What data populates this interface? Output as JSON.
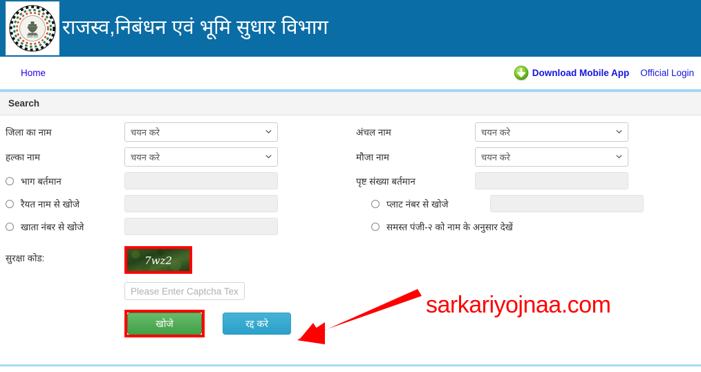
{
  "header": {
    "emblem_alt": "government-emblem",
    "title": "राजस्व,निबंधन एवं भूमि सुधार विभाग",
    "background_color": "#0a6da6"
  },
  "nav": {
    "home_label": "Home",
    "download_label": "Download Mobile App",
    "download_icon": "download-circle-icon",
    "official_login_label": "Official Login",
    "link_color": "#1515e0",
    "accent_rule_color": "#9fd6f5"
  },
  "panel": {
    "title": "Search",
    "left_column": [
      {
        "label": "जिला का नाम",
        "control": "select",
        "value": "चयन करे",
        "has_radio": false
      },
      {
        "label": "हल्का नाम",
        "control": "select",
        "value": "चयन करे",
        "has_radio": false
      },
      {
        "label": "भाग बर्तमान",
        "control": "input",
        "value": "",
        "has_radio": true
      },
      {
        "label": "रैयत नाम से खोजे",
        "control": "input",
        "value": "",
        "has_radio": true
      },
      {
        "label": "खाता नंबर से खोजे",
        "control": "input",
        "value": "",
        "has_radio": true
      }
    ],
    "right_column": [
      {
        "label": "अंचल नाम",
        "control": "select",
        "value": "चयन करे",
        "has_radio": false
      },
      {
        "label": "मौजा नाम",
        "control": "select",
        "value": "चयन करे",
        "has_radio": false
      },
      {
        "label": "पृष्ट संख्या बर्तमान",
        "control": "input",
        "value": "",
        "has_radio": false
      },
      {
        "label": "प्लाट नंबर से खोजे",
        "control": "input",
        "value": "",
        "has_radio": true
      },
      {
        "label": "समस्त पंजी-२ को नाम के अनुसार देखें",
        "control": "none",
        "value": "",
        "has_radio": true
      }
    ]
  },
  "captcha": {
    "label": "सुरक्षा कोड:",
    "image_text": "7wz2",
    "image_background": "#2d4f1e",
    "input_value": "",
    "input_placeholder": "Please Enter Captcha Text",
    "highlight_color": "#ff0000"
  },
  "buttons": {
    "search_label": "खोजे",
    "search_color": "#4caf50",
    "cancel_label": "रद्द करे",
    "cancel_color": "#2ca0c9",
    "search_highlight_color": "#ff0000"
  },
  "annotations": {
    "watermark_text": "sarkariyojnaa.com",
    "watermark_color": "#ff0000",
    "arrow_color": "#ff0000",
    "arrow_name": "pointer-arrow-to-search-button"
  },
  "footer": {
    "rule_color": "#a9d9f2"
  }
}
